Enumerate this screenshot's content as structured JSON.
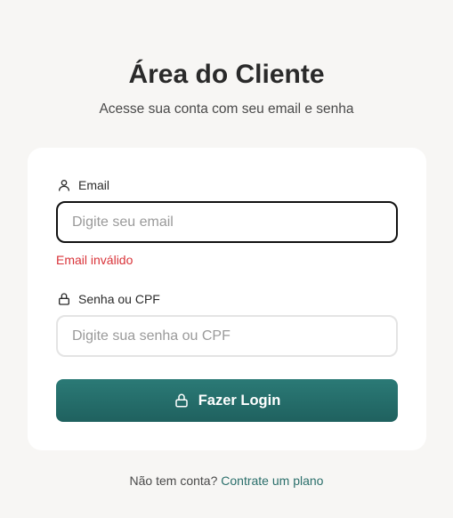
{
  "header": {
    "title": "Área do Cliente",
    "subtitle": "Acesse sua conta com seu email e senha"
  },
  "form": {
    "email": {
      "label": "Email",
      "icon": "user-icon",
      "placeholder": "Digite seu email",
      "value": "",
      "error": "Email inválido"
    },
    "password": {
      "label": "Senha ou CPF",
      "icon": "lock-icon",
      "placeholder": "Digite sua senha ou CPF",
      "value": ""
    },
    "submit": {
      "label": "Fazer Login",
      "icon": "lock-icon"
    }
  },
  "footer": {
    "prompt": "Não tem conta?",
    "link_label": "Contrate um plano"
  },
  "colors": {
    "accent": "#2b7a76",
    "error": "#d9343a",
    "background": "#f7f6f4"
  }
}
